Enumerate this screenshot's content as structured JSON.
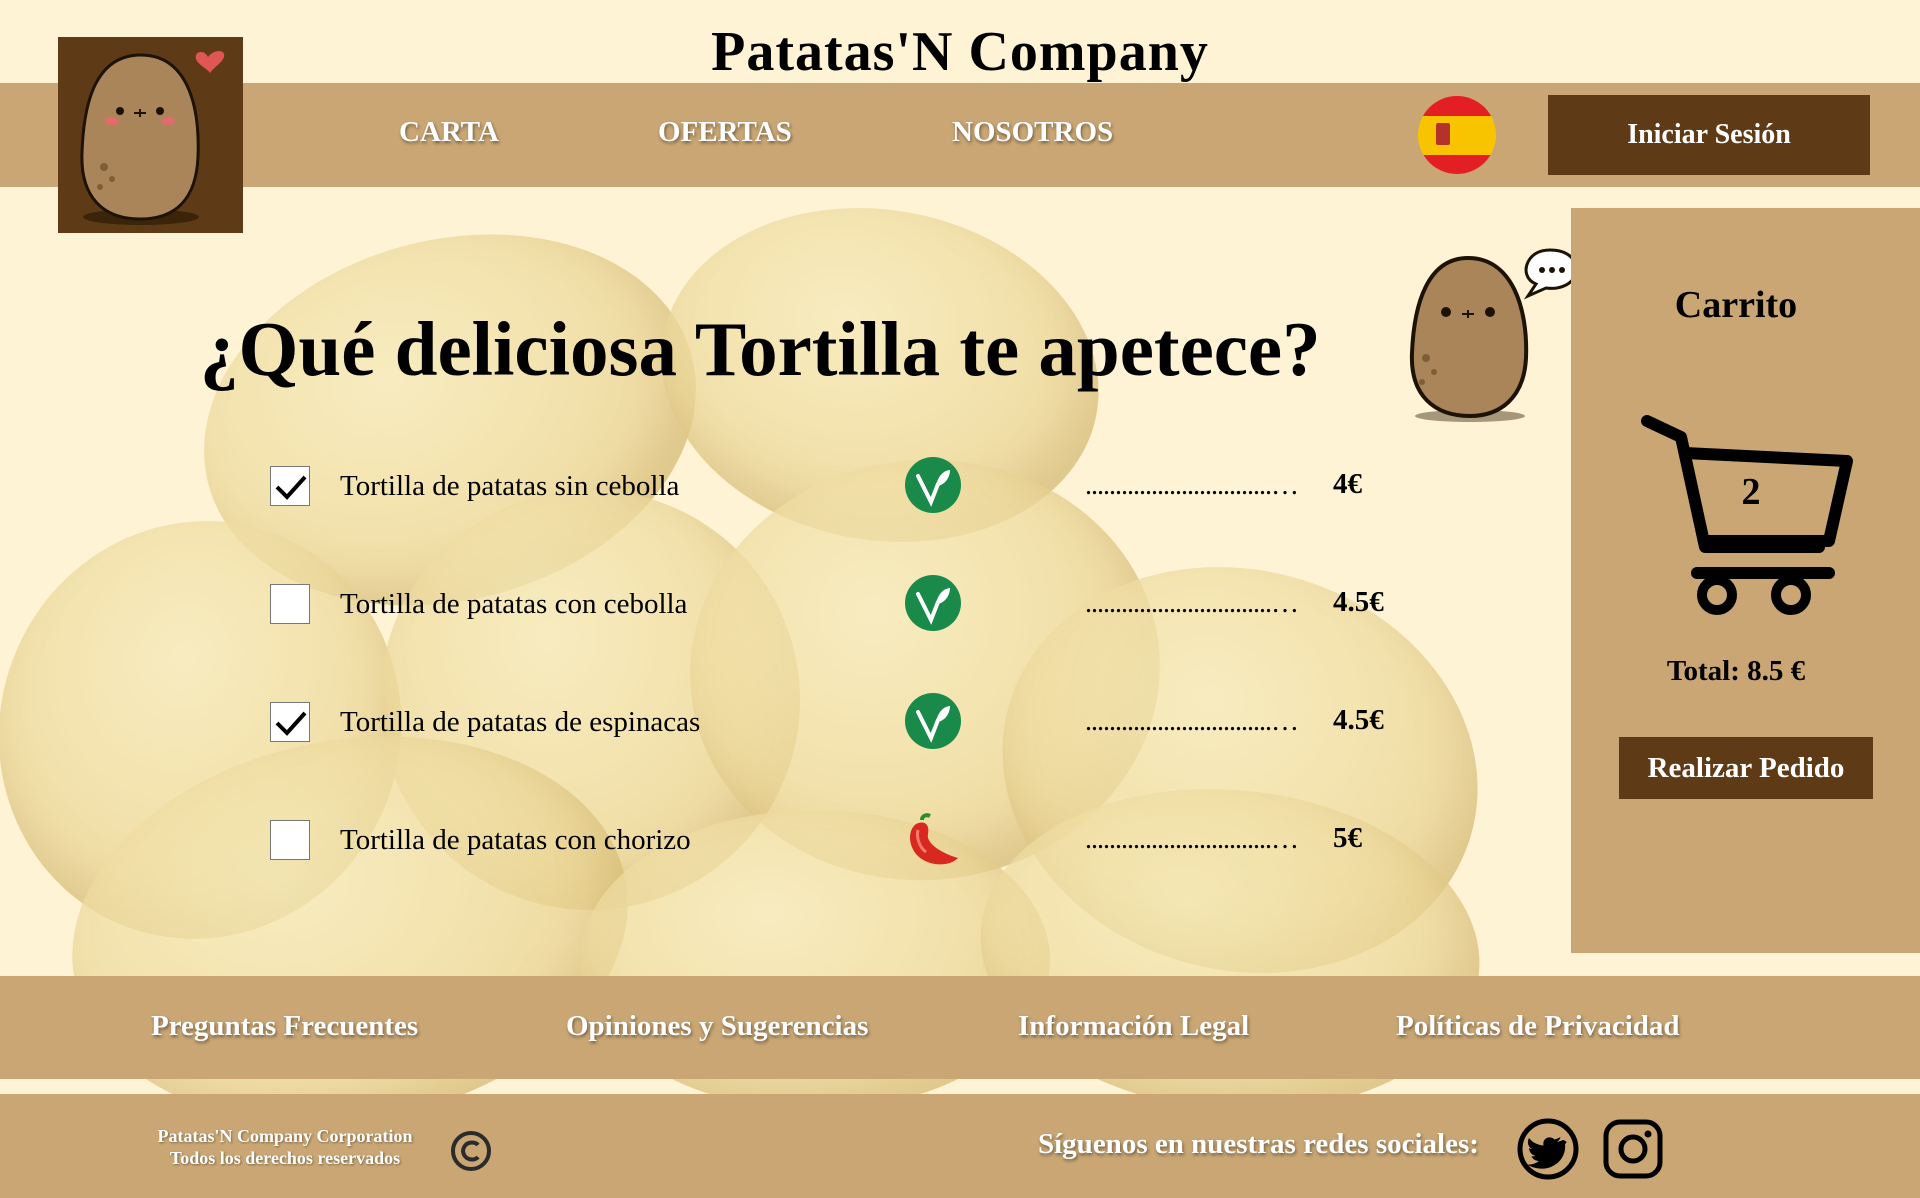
{
  "site": {
    "title": "Patatas'N Company"
  },
  "nav": {
    "items": [
      {
        "label": "CARTA"
      },
      {
        "label": "OFERTAS"
      },
      {
        "label": "NOSOTROS"
      }
    ],
    "login_label": "Iniciar Sesión",
    "language_icon": "spain-flag-icon"
  },
  "main": {
    "headline": "¿Qué deliciosa Tortilla te apetece?",
    "items": [
      {
        "name": "Tortilla de patatas sin cebolla",
        "checked": true,
        "icon": "vegan-leaf-icon",
        "dots": "...............................…",
        "price": "4€"
      },
      {
        "name": "Tortilla de patatas con cebolla",
        "checked": false,
        "icon": "vegan-leaf-icon",
        "dots": "...............................…",
        "price": "4.5€"
      },
      {
        "name": "Tortilla de patatas de espinacas",
        "checked": true,
        "icon": "vegan-leaf-icon",
        "dots": "...............................…",
        "price": "4.5€"
      },
      {
        "name": "Tortilla de patatas con chorizo",
        "checked": false,
        "icon": "chili-pepper-icon",
        "dots": "...............................…",
        "price": "5€"
      }
    ]
  },
  "cart": {
    "title": "Carrito",
    "count": "2",
    "total": "Total: 8.5 €",
    "order_label": "Realizar Pedido"
  },
  "footer": {
    "links": [
      {
        "label": "Preguntas Frecuentes"
      },
      {
        "label": "Opiniones y Sugerencias"
      },
      {
        "label": "Información Legal"
      },
      {
        "label": "Políticas de Privacidad"
      }
    ],
    "copyright_line1": "Patatas'N Company Corporation",
    "copyright_line2": "Todos los derechos reservados",
    "follow_label": "Síguenos en nuestras redes sociales:",
    "social_icons": [
      "twitter-icon",
      "instagram-icon"
    ]
  },
  "colors": {
    "background": "#fef3d4",
    "bar": "#c9a674",
    "dark_brown": "#5e3b16",
    "vegan_green": "#1a8a4a",
    "chili_red": "#d8281f"
  }
}
